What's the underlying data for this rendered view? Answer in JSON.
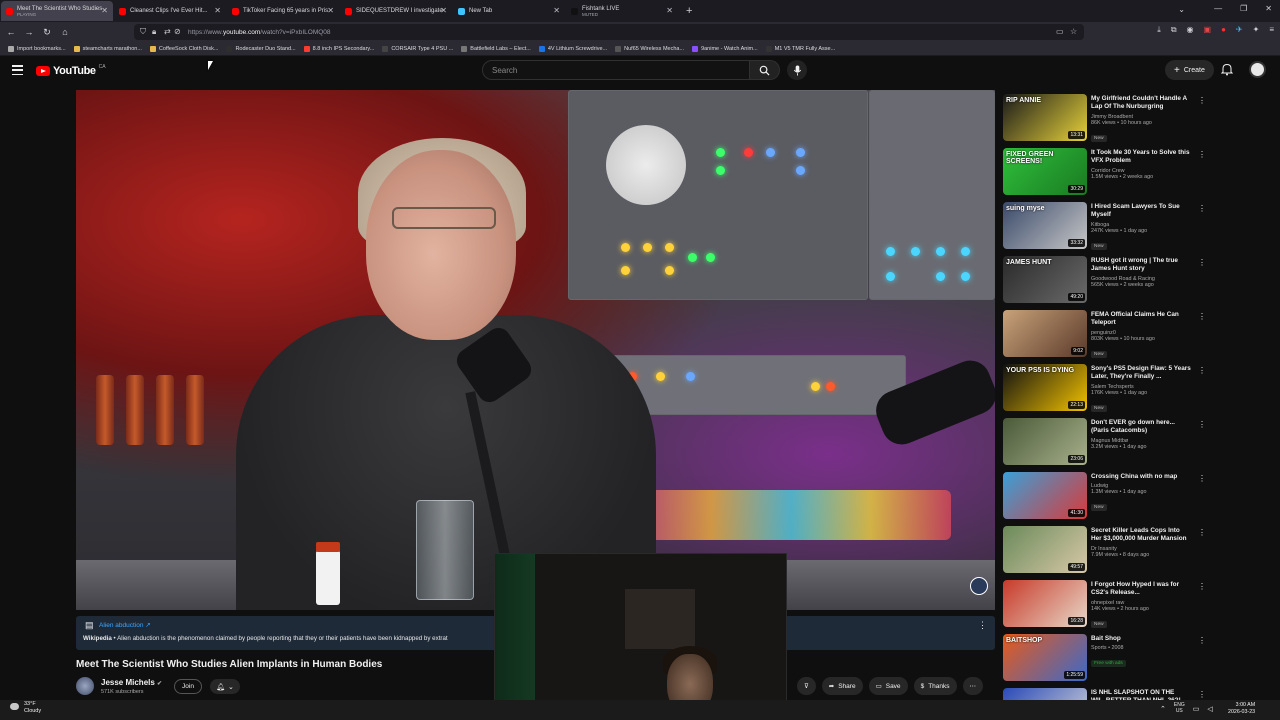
{
  "browser": {
    "tabs": [
      {
        "title": "Meet The Scientist Who Studies",
        "sub": "PLAYING",
        "active": true,
        "color": "#ff0000"
      },
      {
        "title": "Cleanest Clips I've Ever Hit...",
        "sub": "",
        "active": false,
        "color": "#ff0000"
      },
      {
        "title": "TikToker Facing 65 years in Pris",
        "sub": "",
        "active": false,
        "color": "#ff0000"
      },
      {
        "title": "SIDEQUESTDREW I investigate",
        "sub": "",
        "active": false,
        "color": "#ff0000"
      },
      {
        "title": "New Tab",
        "sub": "",
        "active": false,
        "color": "#3ec5ff"
      },
      {
        "title": "Fishtank LIVE",
        "sub": "MUTED",
        "active": false,
        "color": "#111111"
      }
    ],
    "url_prefix": "https://www.",
    "url_domain": "youtube.com",
    "url_rest": "/watch?v=iPxbILOMQ08",
    "bookmarks": [
      {
        "label": "Import bookmarks...",
        "color": "#aaaaaa"
      },
      {
        "label": "steamcharts marathon...",
        "color": "#e5b94a"
      },
      {
        "label": "CoffeeSock Cloth Disk...",
        "color": "#e5b94a"
      },
      {
        "label": "Rodecaster Duo Stand...",
        "color": "#2e2e2e"
      },
      {
        "label": "8.8 inch IPS Secondary...",
        "color": "#ff3b30"
      },
      {
        "label": "CORSAIR Type 4 PSU ...",
        "color": "#444444"
      },
      {
        "label": "Battlefield Labs – Elect...",
        "color": "#777777"
      },
      {
        "label": "4V Lithium Screwdrive...",
        "color": "#1a73e8"
      },
      {
        "label": "Nuf65 Wireless Mecha...",
        "color": "#555555"
      },
      {
        "label": "9anime - Watch Anim...",
        "color": "#8a4fff"
      },
      {
        "label": "M1 V5 TMR Fully Asse...",
        "color": "#333333"
      }
    ]
  },
  "youtube": {
    "logo_text": "YouTube",
    "country": "CA",
    "search_placeholder": "Search",
    "create_label": "Create"
  },
  "video": {
    "info_panel": {
      "title": "Alien abduction",
      "source": "Wikipedia",
      "text": " • Alien abduction is the phenomenon claimed by people reporting that they or their patients have been kidnapped by extrat"
    },
    "title": "Meet The Scientist Who Studies Alien Implants in Human Bodies",
    "channel": "Jesse Michels",
    "subscribers": "571K subscribers",
    "join_label": "Join",
    "actions": {
      "share": "Share",
      "save": "Save",
      "thanks": "Thanks"
    }
  },
  "recommendations": [
    {
      "title": "My Girlfriend Couldn't Handle A Lap Of The Nurburgring",
      "channel": "Jimmy Broadbent",
      "stats": "86K views • 10 hours ago",
      "badge": "New",
      "duration": "13:31",
      "thumb_text": "RIP ANNIE",
      "colors": [
        "#1a1a1a",
        "#e7d23a"
      ]
    },
    {
      "title": "It Took Me 30 Years to Solve this VFX Problem",
      "channel": "Corridor Crew",
      "stats": "1.5M views • 2 weeks ago",
      "badge": "",
      "duration": "30:29",
      "thumb_text": "FIXED GREEN SCREENS!",
      "colors": [
        "#2fbf3b",
        "#1a7a22"
      ]
    },
    {
      "title": "I Hired Scam Lawyers To Sue Myself",
      "channel": "Kitboga",
      "stats": "247K views • 1 day ago",
      "badge": "New",
      "duration": "33:32",
      "thumb_text": "suing myse",
      "colors": [
        "#3a4a6a",
        "#c7c7c7"
      ]
    },
    {
      "title": "RUSH got it wrong | The true James Hunt story",
      "channel": "Goodwood Road & Racing",
      "stats": "565K views • 2 weeks ago",
      "badge": "",
      "duration": "49:20",
      "thumb_text": "JAMES HUNT",
      "colors": [
        "#2a2a2a",
        "#6a6a6a"
      ]
    },
    {
      "title": "FEMA Official Claims He Can Teleport",
      "channel": "penguinz0",
      "stats": "803K views • 10 hours ago",
      "badge": "New",
      "duration": "9:02",
      "thumb_text": "",
      "colors": [
        "#c9a27a",
        "#5a3a2a"
      ]
    },
    {
      "title": "Sony's PS5 Design Flaw: 5 Years Later, They're Finally ...",
      "channel": "Salem Techsperts",
      "stats": "176K views • 1 day ago",
      "badge": "New",
      "duration": "22:13",
      "thumb_text": "YOUR PS5 IS DYING",
      "colors": [
        "#111111",
        "#f2c200"
      ]
    },
    {
      "title": "Don't EVER go down here... (Paris Catacombs)",
      "channel": "Magnus Midtbø",
      "stats": "3.2M views • 1 day ago",
      "badge": "",
      "duration": "23:06",
      "thumb_text": "",
      "colors": [
        "#4a5a3a",
        "#a8b08a"
      ]
    },
    {
      "title": "Crossing China with no map",
      "channel": "Ludwig",
      "stats": "1.3M views • 1 day ago",
      "badge": "New",
      "duration": "41:30",
      "thumb_text": "",
      "colors": [
        "#3aa0d8",
        "#d83a3a"
      ]
    },
    {
      "title": "Secret Killer Leads Cops Into Her $3,000,000 Murder Mansion",
      "channel": "Dr Insanity",
      "stats": "7.9M views • 8 days ago",
      "badge": "",
      "duration": "49:57",
      "thumb_text": "",
      "colors": [
        "#6a8a5a",
        "#d8c8a8"
      ]
    },
    {
      "title": "I Forgot How Hyped I was for CS2's Release...",
      "channel": "ohnepixel raw",
      "stats": "14K views • 2 hours ago",
      "badge": "New",
      "duration": "16:28",
      "thumb_text": "",
      "colors": [
        "#c83a2a",
        "#e8d8c8"
      ]
    },
    {
      "title": "Bait Shop",
      "channel": "Sports • 2008",
      "stats": "",
      "badge": "Free with ads",
      "duration": "1:25:59",
      "thumb_text": "BAITSHOP",
      "colors": [
        "#e85a1a",
        "#3a6ac8"
      ]
    },
    {
      "title": "IS NHL SLAPSHOT ON THE WII...BETTER THAN NHL 26?!",
      "channel": "",
      "stats": "",
      "badge": "",
      "duration": "",
      "thumb_text": "",
      "colors": [
        "#2a4ab8",
        "#d8d8d8"
      ]
    }
  ],
  "taskbar": {
    "temp": "33°F",
    "weather": "Cloudy",
    "lang1": "ENG",
    "lang2": "US",
    "time": "3:00 AM",
    "date": "2026-03-23"
  }
}
